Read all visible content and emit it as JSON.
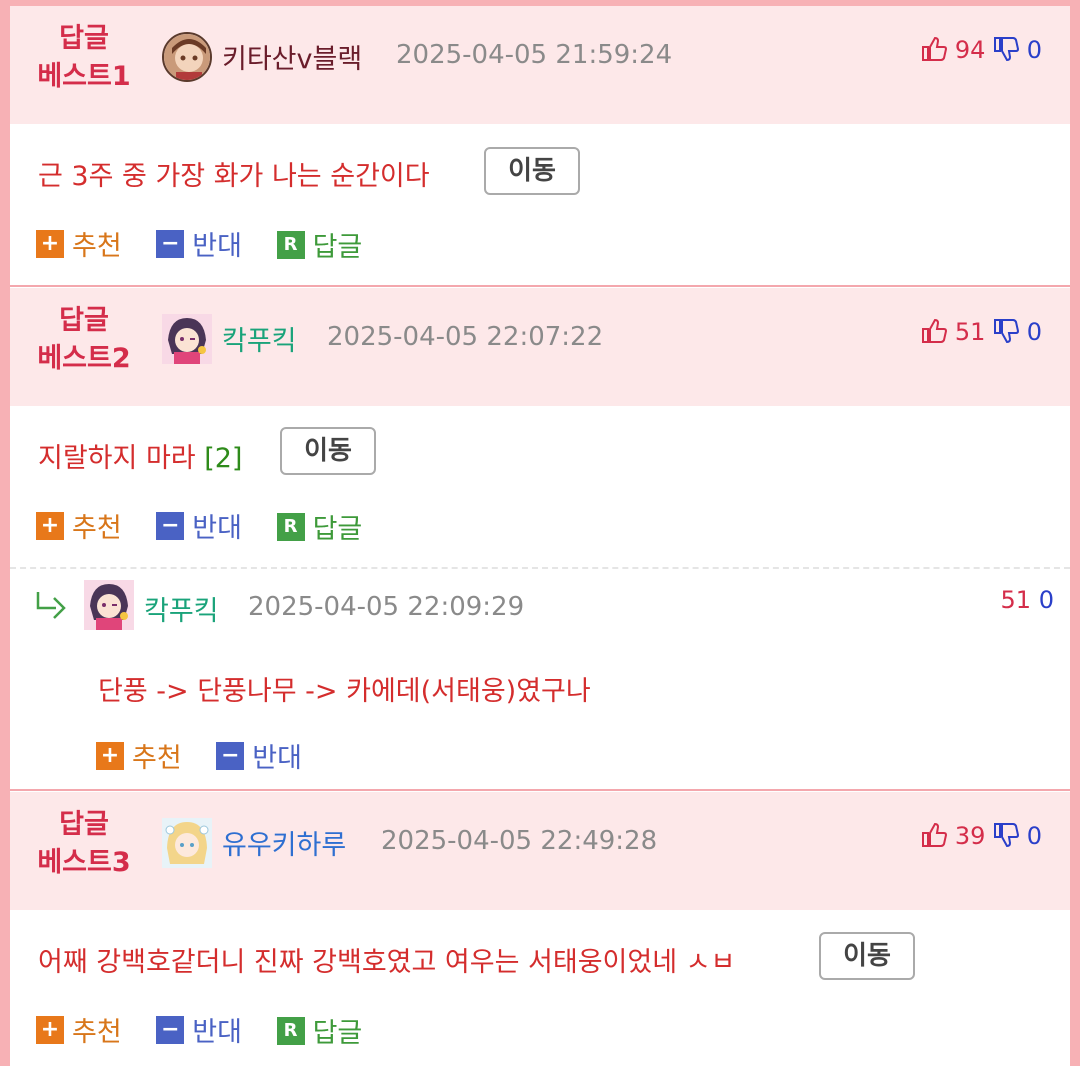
{
  "comments": [
    {
      "best_line1": "답글",
      "best_line2": "베스트1",
      "nick": "키타산v블랙",
      "date": "2025-04-05 21:59:24",
      "up": "94",
      "down": "0",
      "text": "근 3주 중 가장 화가 나는 순간이다",
      "move": "이동",
      "actions": {
        "recommend": "추천",
        "oppose": "반대",
        "reply": "답글"
      }
    },
    {
      "best_line1": "답글",
      "best_line2": "베스트2",
      "nick": "칵푸킥",
      "date": "2025-04-05 22:07:22",
      "up": "51",
      "down": "0",
      "text": "지랄하지 마라",
      "reply_count": "[2]",
      "move": "이동",
      "actions": {
        "recommend": "추천",
        "oppose": "반대",
        "reply": "답글"
      },
      "reply": {
        "nick": "칵푸킥",
        "date": "2025-04-05 22:09:29",
        "up": "51",
        "down": "0",
        "text": "단풍 -> 단풍나무 -> 카에데(서태웅)였구나",
        "actions": {
          "recommend": "추천",
          "oppose": "반대"
        }
      }
    },
    {
      "best_line1": "답글",
      "best_line2": "베스트3",
      "nick": "유우키하루",
      "date": "2025-04-05 22:49:28",
      "up": "39",
      "down": "0",
      "text": "어째 강백호같더니 진짜 강백호였고 여우는 서태웅이었네 ㅅㅂ",
      "move": "이동",
      "actions": {
        "recommend": "추천",
        "oppose": "반대",
        "reply": "답글"
      }
    }
  ],
  "icons": {
    "thumb_up": "thumb-up-icon",
    "thumb_down": "thumb-down-icon",
    "plus": "+",
    "minus": "−",
    "reply": "R"
  },
  "colors": {
    "best_label": "#d42d4a",
    "up_count": "#d42d4a",
    "down_count": "#2a3fc9",
    "comment_text": "#d42d2d",
    "header_bg": "#fde8e9",
    "page_border": "#f7b1b5"
  }
}
